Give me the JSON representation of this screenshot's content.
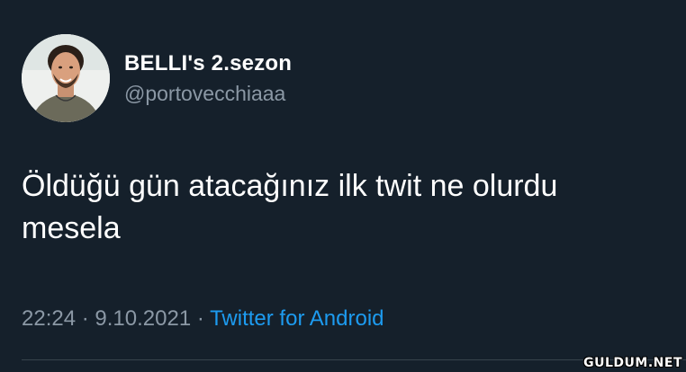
{
  "author": {
    "display_name": "BELLI's 2.sezon",
    "handle": "@portovecchiaaa",
    "avatar_icon": "profile-photo"
  },
  "tweet": {
    "text_line1": "Öldüğü gün atacağınız ilk twit ne olurdu",
    "text_line2": "mesela"
  },
  "meta": {
    "time": "22:24",
    "separator1": " · ",
    "date": "9.10.2021",
    "separator2": " · ",
    "source": "Twitter for Android"
  },
  "watermark": "GULDUM.NET",
  "colors": {
    "background": "#15202b",
    "text": "#ffffff",
    "secondary": "#8b98a5",
    "accent": "#1d9bf0"
  }
}
